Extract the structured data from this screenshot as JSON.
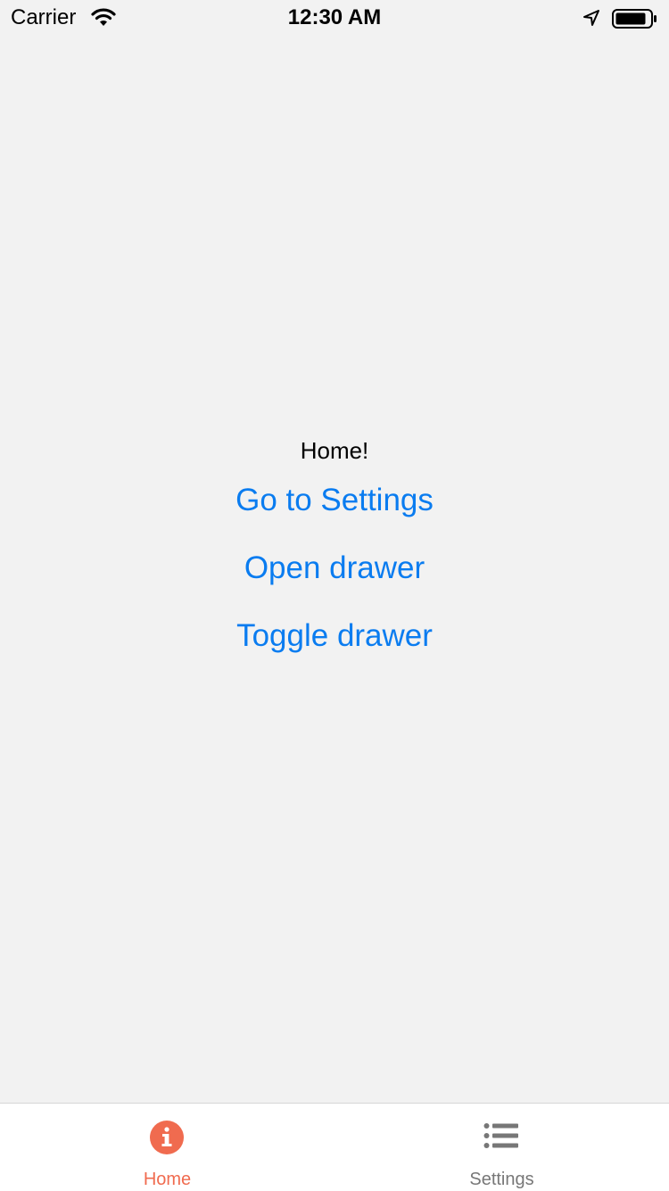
{
  "status_bar": {
    "carrier": "Carrier",
    "time": "12:30 AM",
    "icons": [
      "wifi-icon",
      "location-arrow-icon",
      "battery-icon"
    ]
  },
  "main": {
    "title": "Home!",
    "buttons": [
      {
        "label": "Go to Settings"
      },
      {
        "label": "Open drawer"
      },
      {
        "label": "Toggle drawer"
      }
    ]
  },
  "tab_bar": {
    "tabs": [
      {
        "label": "Home",
        "icon": "info-circle-icon",
        "active": true
      },
      {
        "label": "Settings",
        "icon": "list-icon",
        "active": false
      }
    ]
  },
  "colors": {
    "background": "#f2f2f2",
    "link": "#0a7cf0",
    "active_tab": "#f06b4f",
    "inactive_tab": "#777777"
  }
}
